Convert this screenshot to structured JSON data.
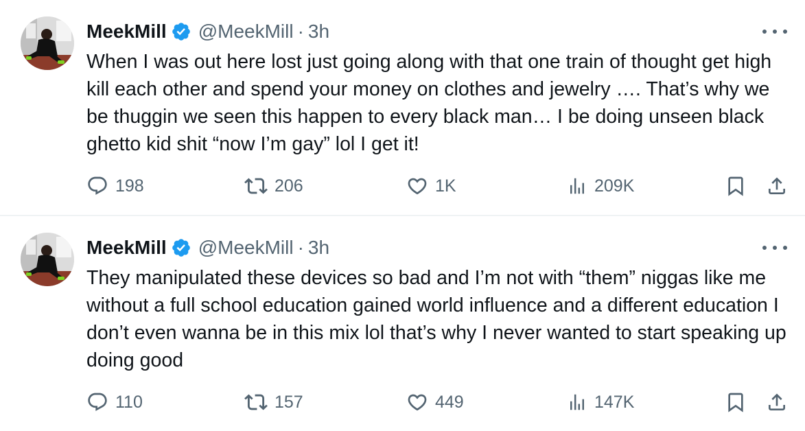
{
  "colors": {
    "text_primary": "#0f1419",
    "text_secondary": "#536471",
    "verified_blue": "#1d9bf0",
    "divider": "#eff3f4"
  },
  "tweets": [
    {
      "author_name": "MeekMill",
      "handle": "@MeekMill",
      "separator": "·",
      "time": "3h",
      "text": "When I was out here lost just going along with that one train of thought get high kill each other and spend your money on clothes and jewelry …. That’s why we be thuggin we seen this happen to every black man… I be doing unseen black ghetto kid shit “now I’m gay” lol I get it!",
      "replies": "198",
      "reposts": "206",
      "likes": "1K",
      "views": "209K"
    },
    {
      "author_name": "MeekMill",
      "handle": "@MeekMill",
      "separator": "·",
      "time": "3h",
      "text": "They manipulated these devices so bad and I’m not with “them” niggas like me without a full school education gained world influence and a different education I don’t even wanna be in this mix lol that’s why I never wanted to start speaking up doing good",
      "replies": "110",
      "reposts": "157",
      "likes": "449",
      "views": "147K"
    }
  ],
  "icons": {
    "reply": "reply-icon",
    "repost": "repost-icon",
    "like": "heart-icon",
    "views": "views-chart-icon",
    "bookmark": "bookmark-icon",
    "share": "share-icon",
    "more": "more-dots-icon",
    "verified": "verified-badge-icon"
  }
}
